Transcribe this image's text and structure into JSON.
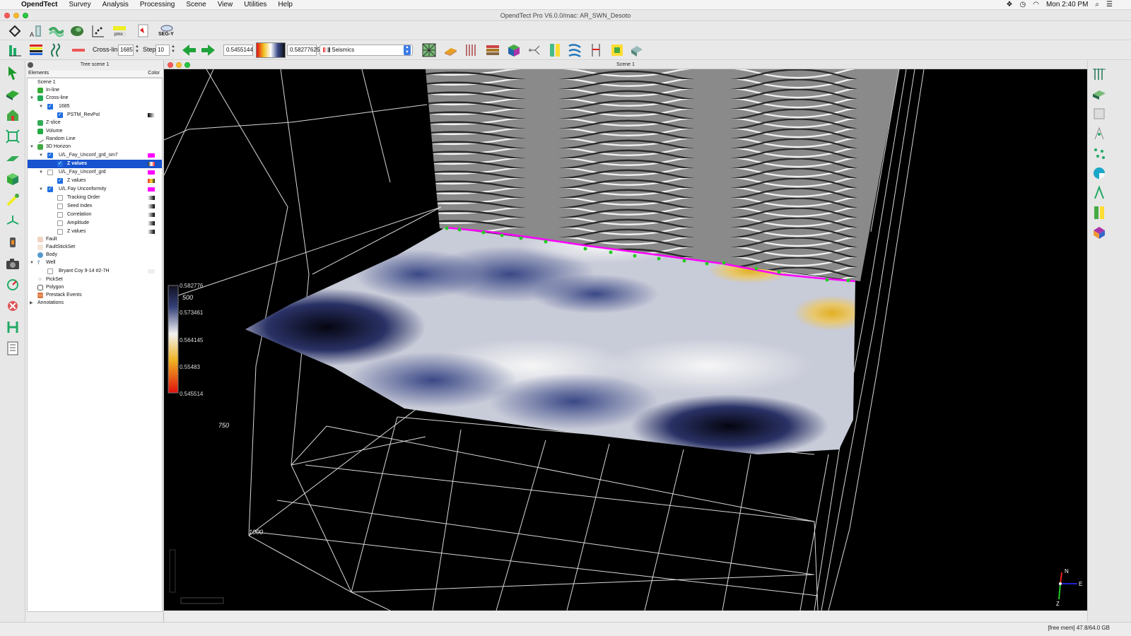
{
  "menubar": {
    "app": "OpendTect",
    "items": [
      "Survey",
      "Analysis",
      "Processing",
      "Scene",
      "View",
      "Utilities",
      "Help"
    ],
    "clock": "Mon 2:40 PM"
  },
  "window": {
    "title": "OpendTect Pro V6.0.0/mac: AR_SWN_Desoto"
  },
  "toolbar1": {
    "segy_label": "SEG-Y"
  },
  "toolbar2": {
    "crossline_label": "Cross-line",
    "crossline_value": "1685",
    "step_label": "Step",
    "step_value": "10",
    "range_min": "0.5455144",
    "range_max": "0.58277625",
    "colortable": "Seismics"
  },
  "tree": {
    "title": "Tree scene 1",
    "col_elements": "Elements",
    "col_color": "Color",
    "rows": [
      {
        "label": "Scene 1"
      },
      {
        "label": "In-line"
      },
      {
        "label": "Cross-line"
      },
      {
        "label": "1685"
      },
      {
        "label": "PSTM_RevPol"
      },
      {
        "label": "Z-slice"
      },
      {
        "label": "Volume"
      },
      {
        "label": "Random Line"
      },
      {
        "label": "3D Horizon"
      },
      {
        "label": "U/L_Fay_Unconf_grd_sm7"
      },
      {
        "label": "Z values"
      },
      {
        "label": "U/L_Fay_Unconf_grd"
      },
      {
        "label": "Z values"
      },
      {
        "label": "U/L Fay Unconformity"
      },
      {
        "label": "Tracking Order"
      },
      {
        "label": "Seed Index"
      },
      {
        "label": "Correlation"
      },
      {
        "label": "Amplitude"
      },
      {
        "label": "Z values"
      },
      {
        "label": "Fault"
      },
      {
        "label": "FaultStickSet"
      },
      {
        "label": "Body"
      },
      {
        "label": "Well"
      },
      {
        "label": "Bryant Coy 9-14 #2-7H"
      },
      {
        "label": "PickSet"
      },
      {
        "label": "Polygon"
      },
      {
        "label": "Prestack Events"
      },
      {
        "label": "Annotations"
      }
    ]
  },
  "scene": {
    "title": "Scene 1",
    "colorbar_labels": [
      "0.582776",
      "0.573461",
      "0.564145",
      "0.55483",
      "0.545514"
    ],
    "axis_labels": [
      "500",
      "750",
      "1000"
    ],
    "compass": {
      "n": "N",
      "e": "E",
      "z": "Z"
    }
  },
  "status": {
    "text": "[free mem] 47.8/64.0 GB"
  },
  "colors": {
    "selection": "#1752cf",
    "horizon_edge": "#ff00ff",
    "seed_points": "#22cc22"
  }
}
